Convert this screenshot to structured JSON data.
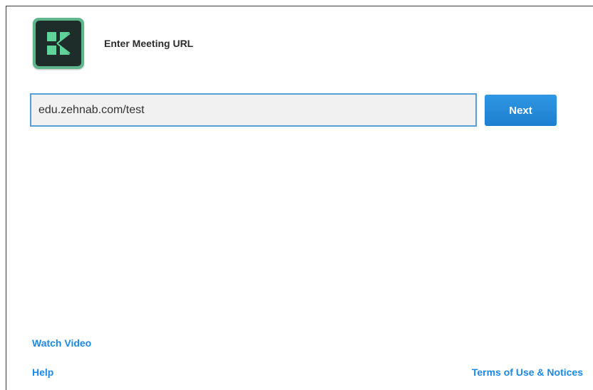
{
  "app": {
    "logo_icon": "adobe-connect-icon",
    "logo_colors": {
      "border": "#5fb58c",
      "background": "#1f2d2a",
      "mark": "#5fd39a"
    }
  },
  "header": {
    "title": "Enter Meeting URL"
  },
  "form": {
    "url_value": "edu.zehnab.com/test",
    "next_label": "Next"
  },
  "footer": {
    "watch_video_label": "Watch Video",
    "help_label": "Help",
    "terms_label": "Terms of Use & Notices"
  },
  "colors": {
    "accent": "#1e88e5",
    "input_border": "#5a9fd4",
    "input_background": "#f1f1f1"
  }
}
